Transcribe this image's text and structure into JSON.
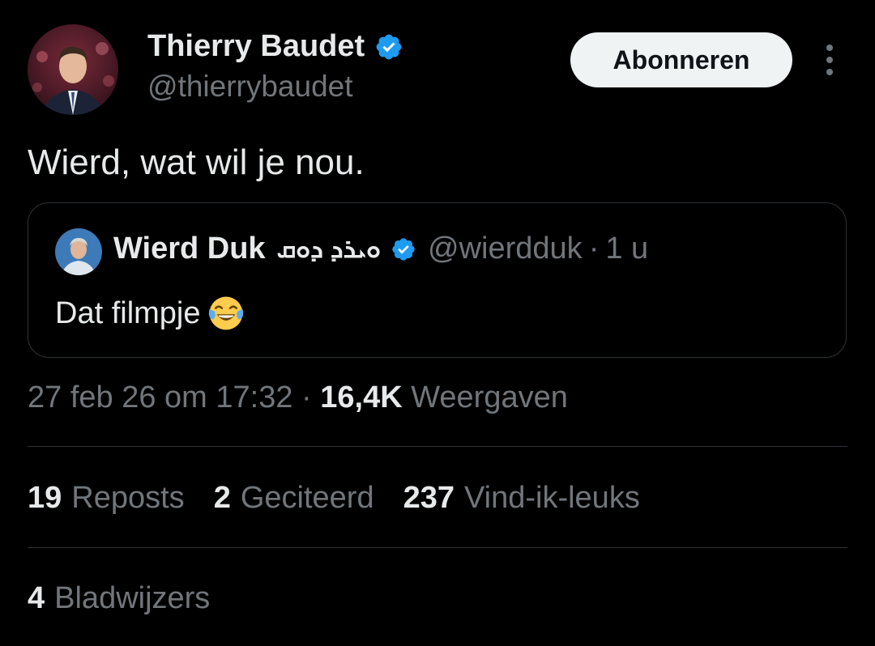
{
  "author": {
    "name": "Thierry Baudet",
    "handle": "@thierrybaudet",
    "verified_icon": "verified-badge-icon",
    "avatar_icon": "profile-photo"
  },
  "follow_button": {
    "label": "Abonneren"
  },
  "more_icon": "more-options-icon",
  "tweet": {
    "text": "Wierd, wat wil je nou."
  },
  "quote": {
    "name": "Wierd Duk",
    "name_suffix": "ܘܝܪܕ ܕܘܩ",
    "handle": "@wierdduk",
    "separator": "·",
    "time": "1 u",
    "text": "Dat filmpje",
    "emoji_icon": "face-with-tears-of-joy-icon"
  },
  "meta": {
    "timestamp": "27 feb 26 om 17:32",
    "separator": "·",
    "views_count": "16,4K",
    "views_label": "Weergaven"
  },
  "stats": {
    "reposts_count": "19",
    "reposts_label": "Reposts",
    "quotes_count": "2",
    "quotes_label": "Geciteerd",
    "likes_count": "237",
    "likes_label": "Vind-ik-leuks",
    "bookmarks_count": "4",
    "bookmarks_label": "Bladwijzers"
  },
  "colors": {
    "background": "#000000",
    "primary_text": "#e7e9ea",
    "secondary_text": "#71767b",
    "verified": "#1d9bf0",
    "border": "#2f3336",
    "button_bg": "#eff3f4"
  }
}
